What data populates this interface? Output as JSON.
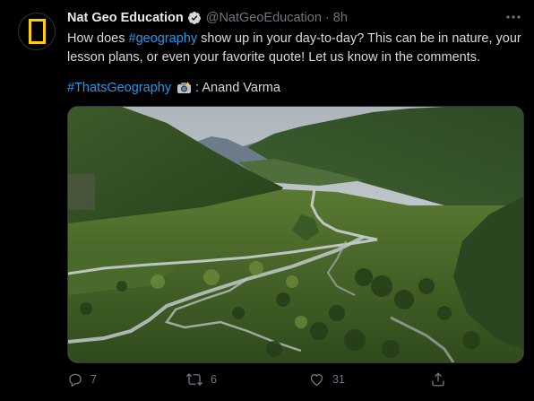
{
  "tweet": {
    "author_name": "Nat Geo Education",
    "handle": "@NatGeoEducation",
    "separator": "·",
    "time": "8h",
    "body_part1": "How does ",
    "hashtag1": "#geography",
    "body_part2": " show up in your day-to-day? This can be in nature, your lesson plans, or even your favorite quote! Let us know in the comments.",
    "hashtag2": "#ThatsGeography",
    "credit": ": Anand Varma",
    "stats": {
      "replies": "7",
      "retweets": "6",
      "likes": "31"
    }
  },
  "icons": {
    "avatar": "nat-geo-yellow-border-logo",
    "verified": "verified-badge-icon",
    "more": "more-options-icon",
    "camera": "camera-icon",
    "reply": "reply-icon",
    "retweet": "retweet-icon",
    "like": "heart-icon",
    "share": "share-icon"
  },
  "colors": {
    "background": "#000000",
    "text": "#d9d9d9",
    "muted": "#6e767d",
    "link": "#1d9bf0",
    "brand_yellow": "#ffce00"
  }
}
